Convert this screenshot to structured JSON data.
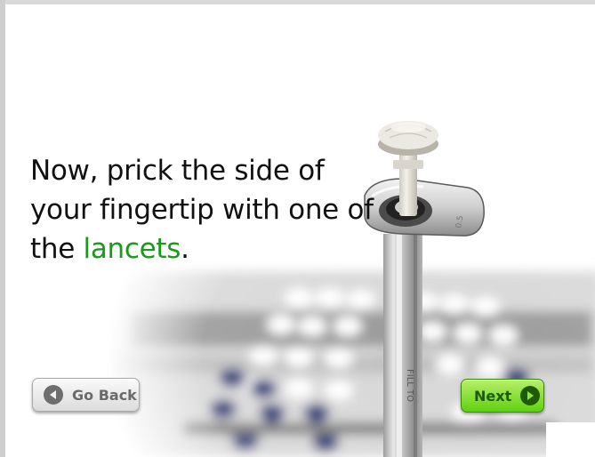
{
  "instruction": {
    "line1": "Now, prick the side of",
    "line2": "your fingertip with one of",
    "line3_prefix": "the ",
    "line3_highlight": "lancets",
    "line3_suffix": "."
  },
  "image": {
    "icon": "lancet-photo"
  },
  "navigation": {
    "back_label": "Go Back",
    "back_icon": "circle-left-arrow-icon",
    "next_label": "Next",
    "next_icon": "circle-right-arrow-icon"
  },
  "colors": {
    "highlight": "#1a9a1a",
    "next_button": "#6edb1a",
    "back_button": "#e6e6e6"
  }
}
